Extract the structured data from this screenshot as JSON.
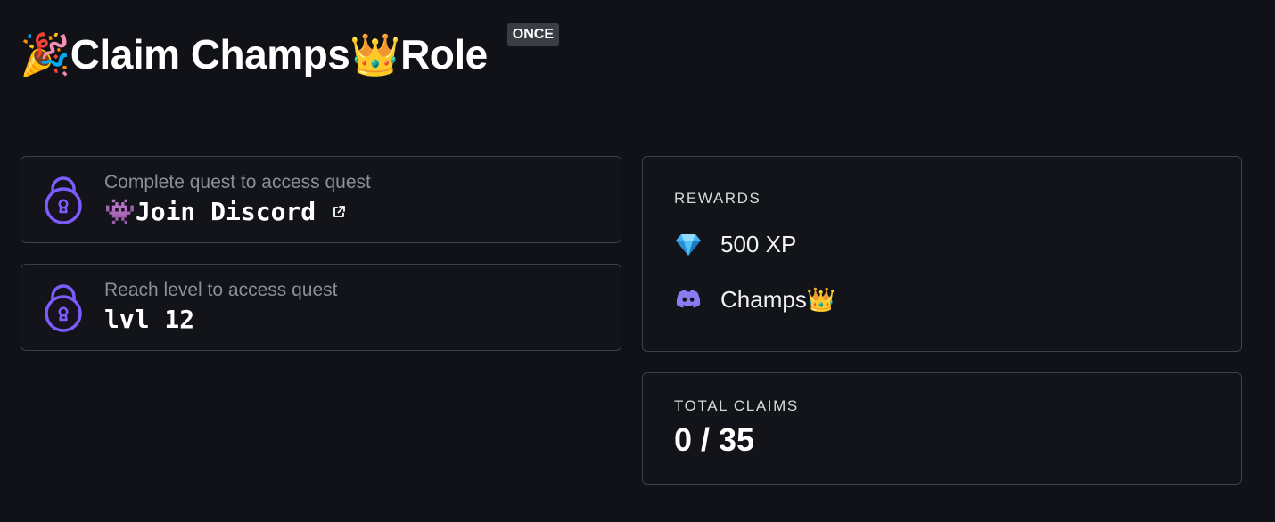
{
  "header": {
    "title": "🎉Claim Champs👑Role",
    "badge": "ONCE"
  },
  "quests": [
    {
      "subtitle": "Complete quest to access quest",
      "name": "👾Join Discord",
      "icon": "lock-icon",
      "link_icon": "external-link-icon"
    },
    {
      "subtitle": "Reach level to access quest",
      "name": "lvl 12",
      "icon": "lock-icon"
    }
  ],
  "rewards": {
    "label": "REWARDS",
    "items": [
      {
        "icon": "diamond-icon",
        "text": "500 XP"
      },
      {
        "icon": "discord-icon",
        "text": "Champs👑"
      }
    ]
  },
  "claims": {
    "label": "TOTAL CLAIMS",
    "value": "0 / 35"
  },
  "colors": {
    "background": "#101217",
    "lock_accent": "#7c5cff",
    "diamond": "#3fb4f5",
    "discord": "#8b7cf6",
    "border": "#3d4047"
  }
}
